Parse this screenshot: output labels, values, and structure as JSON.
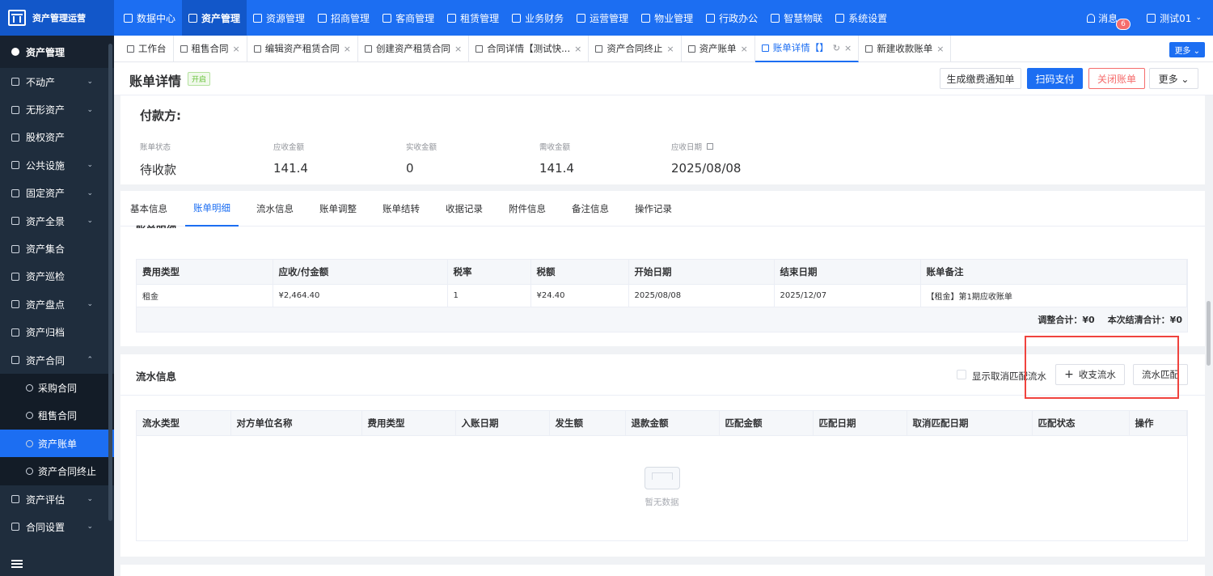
{
  "app": {
    "brand": "资产管理运营"
  },
  "topnav": [
    {
      "label": "数据中心",
      "active": false
    },
    {
      "label": "资产管理",
      "active": true
    },
    {
      "label": "资源管理",
      "active": false
    },
    {
      "label": "招商管理",
      "active": false
    },
    {
      "label": "客商管理",
      "active": false
    },
    {
      "label": "租赁管理",
      "active": false
    },
    {
      "label": "业务财务",
      "active": false
    },
    {
      "label": "运营管理",
      "active": false
    },
    {
      "label": "物业管理",
      "active": false
    },
    {
      "label": "行政办公",
      "active": false
    },
    {
      "label": "智慧物联",
      "active": false
    },
    {
      "label": "系统设置",
      "active": false
    }
  ],
  "user": {
    "messages_label": "消息",
    "messages_count": "6",
    "name": "测试01"
  },
  "sidebar": {
    "header": "资产管理",
    "items": [
      {
        "label": "不动产",
        "chevron": "⌄"
      },
      {
        "label": "无形资产",
        "chevron": "⌄"
      },
      {
        "label": "股权资产",
        "chevron": ""
      },
      {
        "label": "公共设施",
        "chevron": "⌄"
      },
      {
        "label": "固定资产",
        "chevron": "⌄"
      },
      {
        "label": "资产全景",
        "chevron": "⌄"
      },
      {
        "label": "资产集合",
        "chevron": ""
      },
      {
        "label": "资产巡检",
        "chevron": ""
      },
      {
        "label": "资产盘点",
        "chevron": "⌄"
      },
      {
        "label": "资产归档",
        "chevron": ""
      },
      {
        "label": "资产合同",
        "chevron": "⌃"
      }
    ],
    "subitems": [
      {
        "label": "采购合同",
        "active": false
      },
      {
        "label": "租售合同",
        "active": false
      },
      {
        "label": "资产账单",
        "active": true
      },
      {
        "label": "资产合同终止",
        "active": false
      }
    ],
    "items_after": [
      {
        "label": "资产评估",
        "chevron": "⌄"
      },
      {
        "label": "合同设置",
        "chevron": "⌄"
      }
    ]
  },
  "tabs": [
    {
      "label": "工作台",
      "closable": false,
      "active": false
    },
    {
      "label": "租售合同",
      "closable": true,
      "active": false
    },
    {
      "label": "编辑资产租赁合同",
      "closable": true,
      "active": false
    },
    {
      "label": "创建资产租赁合同",
      "closable": true,
      "active": false
    },
    {
      "label": "合同详情【测试快...",
      "closable": true,
      "active": false
    },
    {
      "label": "资产合同终止",
      "closable": true,
      "active": false
    },
    {
      "label": "资产账单",
      "closable": true,
      "active": false
    },
    {
      "label": "账单详情【】",
      "closable": true,
      "active": true
    },
    {
      "label": "新建收款账单",
      "closable": true,
      "active": false
    }
  ],
  "tabs_more": "更多 ⌄",
  "header": {
    "title": "账单详情",
    "status": "开启",
    "buttons": {
      "generate": "生成缴费通知单",
      "scan_pay": "扫码支付",
      "close_bill": "关闭账单",
      "more": "更多 ⌄"
    }
  },
  "summary": {
    "payer_label": "付款方:",
    "stats": [
      {
        "label": "账单状态",
        "value": "待收款"
      },
      {
        "label": "应收金额",
        "value": "141.4"
      },
      {
        "label": "实收金额",
        "value": "0"
      },
      {
        "label": "需收金额",
        "value": "141.4"
      },
      {
        "label": "应收日期",
        "value": "2025/08/08"
      }
    ]
  },
  "detail_tabs": [
    {
      "label": "基本信息",
      "active": false
    },
    {
      "label": "账单明细",
      "active": true
    },
    {
      "label": "流水信息",
      "active": false
    },
    {
      "label": "账单调整",
      "active": false
    },
    {
      "label": "账单结转",
      "active": false
    },
    {
      "label": "收据记录",
      "active": false
    },
    {
      "label": "附件信息",
      "active": false
    },
    {
      "label": "备注信息",
      "active": false
    },
    {
      "label": "操作记录",
      "active": false
    }
  ],
  "bill_table": {
    "section_title": "账单明细",
    "columns": [
      "费用类型",
      "应收/付金额",
      "税率",
      "税额",
      "开始日期",
      "结束日期",
      "账单备注"
    ],
    "rows": [
      [
        "租金",
        "¥2,464.40",
        "1",
        "¥24.40",
        "2025/08/08",
        "2025/12/07",
        "【租金】第1期应收账单"
      ]
    ],
    "adjust_total": "调整合计：¥0",
    "settle_total": "本次结清合计：¥0"
  },
  "flow": {
    "title": "流水信息",
    "show_cancelled_label": "显示取消匹配流水",
    "add_button": "收支流水",
    "match_button": "流水匹配",
    "columns": [
      "流水类型",
      "对方单位名称",
      "费用类型",
      "入账日期",
      "发生额",
      "退款金额",
      "匹配金额",
      "匹配日期",
      "取消匹配日期",
      "匹配状态",
      "操作"
    ],
    "empty_text": "暂无数据"
  }
}
